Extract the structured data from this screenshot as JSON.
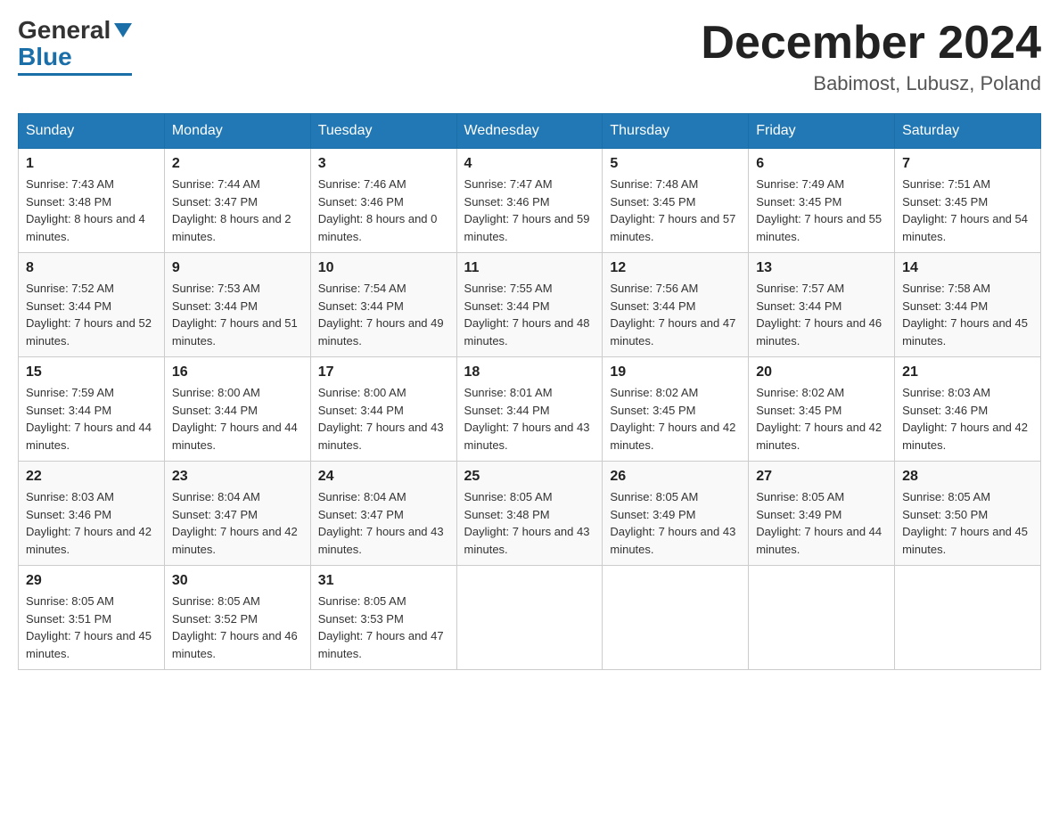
{
  "header": {
    "logo_general": "General",
    "logo_blue": "Blue",
    "month_title": "December 2024",
    "location": "Babimost, Lubusz, Poland"
  },
  "days_of_week": [
    "Sunday",
    "Monday",
    "Tuesday",
    "Wednesday",
    "Thursday",
    "Friday",
    "Saturday"
  ],
  "weeks": [
    [
      {
        "day": "1",
        "sunrise": "7:43 AM",
        "sunset": "3:48 PM",
        "daylight": "8 hours and 4 minutes."
      },
      {
        "day": "2",
        "sunrise": "7:44 AM",
        "sunset": "3:47 PM",
        "daylight": "8 hours and 2 minutes."
      },
      {
        "day": "3",
        "sunrise": "7:46 AM",
        "sunset": "3:46 PM",
        "daylight": "8 hours and 0 minutes."
      },
      {
        "day": "4",
        "sunrise": "7:47 AM",
        "sunset": "3:46 PM",
        "daylight": "7 hours and 59 minutes."
      },
      {
        "day": "5",
        "sunrise": "7:48 AM",
        "sunset": "3:45 PM",
        "daylight": "7 hours and 57 minutes."
      },
      {
        "day": "6",
        "sunrise": "7:49 AM",
        "sunset": "3:45 PM",
        "daylight": "7 hours and 55 minutes."
      },
      {
        "day": "7",
        "sunrise": "7:51 AM",
        "sunset": "3:45 PM",
        "daylight": "7 hours and 54 minutes."
      }
    ],
    [
      {
        "day": "8",
        "sunrise": "7:52 AM",
        "sunset": "3:44 PM",
        "daylight": "7 hours and 52 minutes."
      },
      {
        "day": "9",
        "sunrise": "7:53 AM",
        "sunset": "3:44 PM",
        "daylight": "7 hours and 51 minutes."
      },
      {
        "day": "10",
        "sunrise": "7:54 AM",
        "sunset": "3:44 PM",
        "daylight": "7 hours and 49 minutes."
      },
      {
        "day": "11",
        "sunrise": "7:55 AM",
        "sunset": "3:44 PM",
        "daylight": "7 hours and 48 minutes."
      },
      {
        "day": "12",
        "sunrise": "7:56 AM",
        "sunset": "3:44 PM",
        "daylight": "7 hours and 47 minutes."
      },
      {
        "day": "13",
        "sunrise": "7:57 AM",
        "sunset": "3:44 PM",
        "daylight": "7 hours and 46 minutes."
      },
      {
        "day": "14",
        "sunrise": "7:58 AM",
        "sunset": "3:44 PM",
        "daylight": "7 hours and 45 minutes."
      }
    ],
    [
      {
        "day": "15",
        "sunrise": "7:59 AM",
        "sunset": "3:44 PM",
        "daylight": "7 hours and 44 minutes."
      },
      {
        "day": "16",
        "sunrise": "8:00 AM",
        "sunset": "3:44 PM",
        "daylight": "7 hours and 44 minutes."
      },
      {
        "day": "17",
        "sunrise": "8:00 AM",
        "sunset": "3:44 PM",
        "daylight": "7 hours and 43 minutes."
      },
      {
        "day": "18",
        "sunrise": "8:01 AM",
        "sunset": "3:44 PM",
        "daylight": "7 hours and 43 minutes."
      },
      {
        "day": "19",
        "sunrise": "8:02 AM",
        "sunset": "3:45 PM",
        "daylight": "7 hours and 42 minutes."
      },
      {
        "day": "20",
        "sunrise": "8:02 AM",
        "sunset": "3:45 PM",
        "daylight": "7 hours and 42 minutes."
      },
      {
        "day": "21",
        "sunrise": "8:03 AM",
        "sunset": "3:46 PM",
        "daylight": "7 hours and 42 minutes."
      }
    ],
    [
      {
        "day": "22",
        "sunrise": "8:03 AM",
        "sunset": "3:46 PM",
        "daylight": "7 hours and 42 minutes."
      },
      {
        "day": "23",
        "sunrise": "8:04 AM",
        "sunset": "3:47 PM",
        "daylight": "7 hours and 42 minutes."
      },
      {
        "day": "24",
        "sunrise": "8:04 AM",
        "sunset": "3:47 PM",
        "daylight": "7 hours and 43 minutes."
      },
      {
        "day": "25",
        "sunrise": "8:05 AM",
        "sunset": "3:48 PM",
        "daylight": "7 hours and 43 minutes."
      },
      {
        "day": "26",
        "sunrise": "8:05 AM",
        "sunset": "3:49 PM",
        "daylight": "7 hours and 43 minutes."
      },
      {
        "day": "27",
        "sunrise": "8:05 AM",
        "sunset": "3:49 PM",
        "daylight": "7 hours and 44 minutes."
      },
      {
        "day": "28",
        "sunrise": "8:05 AM",
        "sunset": "3:50 PM",
        "daylight": "7 hours and 45 minutes."
      }
    ],
    [
      {
        "day": "29",
        "sunrise": "8:05 AM",
        "sunset": "3:51 PM",
        "daylight": "7 hours and 45 minutes."
      },
      {
        "day": "30",
        "sunrise": "8:05 AM",
        "sunset": "3:52 PM",
        "daylight": "7 hours and 46 minutes."
      },
      {
        "day": "31",
        "sunrise": "8:05 AM",
        "sunset": "3:53 PM",
        "daylight": "7 hours and 47 minutes."
      },
      null,
      null,
      null,
      null
    ]
  ]
}
